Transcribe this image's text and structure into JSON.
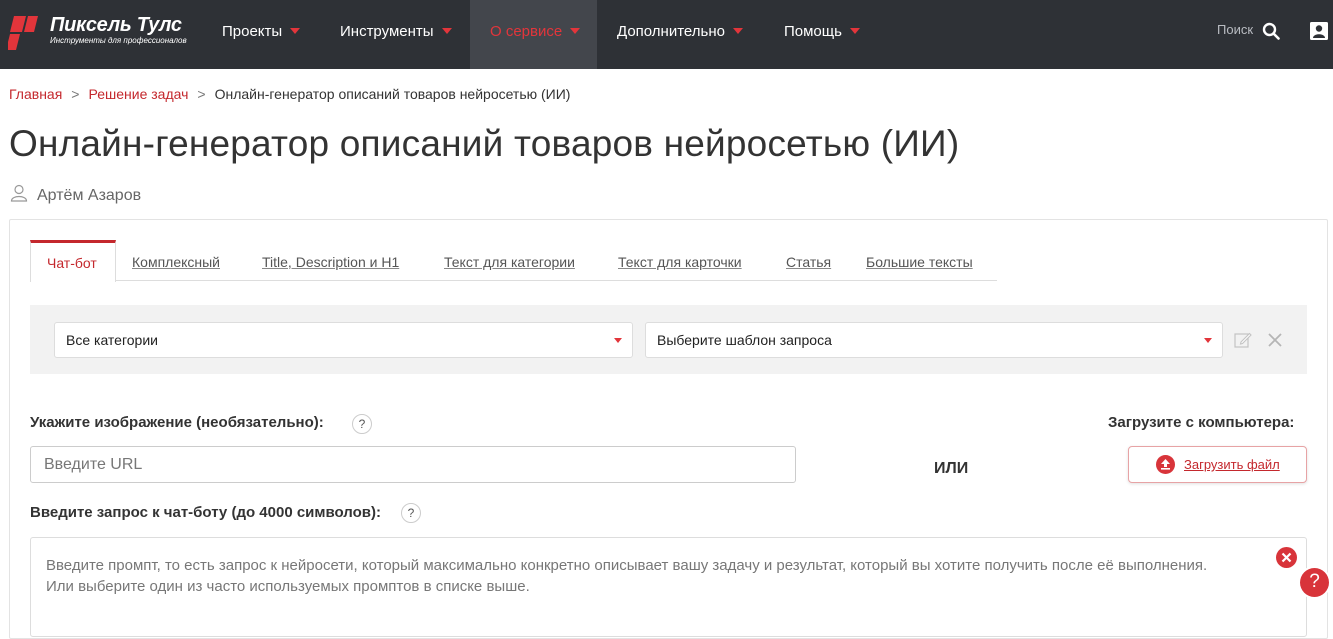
{
  "nav": {
    "logo_title": "Пиксель Тулс",
    "logo_subtitle": "Инструменты для профессионалов",
    "items": [
      {
        "label": "Проекты"
      },
      {
        "label": "Инструменты"
      },
      {
        "label": "О сервисе"
      },
      {
        "label": "Дополнительно"
      },
      {
        "label": "Помощь"
      }
    ],
    "search_label": "Поиск"
  },
  "breadcrumb": {
    "home": "Главная",
    "section": "Решение задач",
    "current": "Онлайн-генератор описаний товаров нейросетью (ИИ)",
    "separator": ">"
  },
  "page": {
    "title": "Онлайн-генератор описаний товаров нейросетью (ИИ)",
    "author": "Артём Азаров"
  },
  "tabs": [
    {
      "label": "Чат-бот"
    },
    {
      "label": "Комплексный"
    },
    {
      "label": "Title, Description и H1"
    },
    {
      "label": "Текст для категории"
    },
    {
      "label": "Текст для карточки"
    },
    {
      "label": "Статья"
    },
    {
      "label": "Большие тексты"
    }
  ],
  "filters": {
    "category_value": "Все категории",
    "template_value": "Выберите шаблон запроса"
  },
  "image": {
    "label": "Укажите изображение (необязательно):",
    "help": "?",
    "url_placeholder": "Введите URL",
    "or_text": "ИЛИ",
    "upload_label": "Загрузите с компьютера:",
    "upload_button": "Загрузить файл"
  },
  "prompt": {
    "label": "Введите запрос к чат-боту (до 4000 символов):",
    "help": "?",
    "placeholder": "Введите промпт, то есть запрос к нейросети, который максимально конкретно описывает вашу задачу и результат, который вы хотите получить после её выполнения. Или выберите один из часто используемых промптов в списке выше."
  },
  "help_float": "?",
  "colors": {
    "header_bg": "#2e3136",
    "accent": "#e2353b",
    "link": "#c4282d"
  }
}
